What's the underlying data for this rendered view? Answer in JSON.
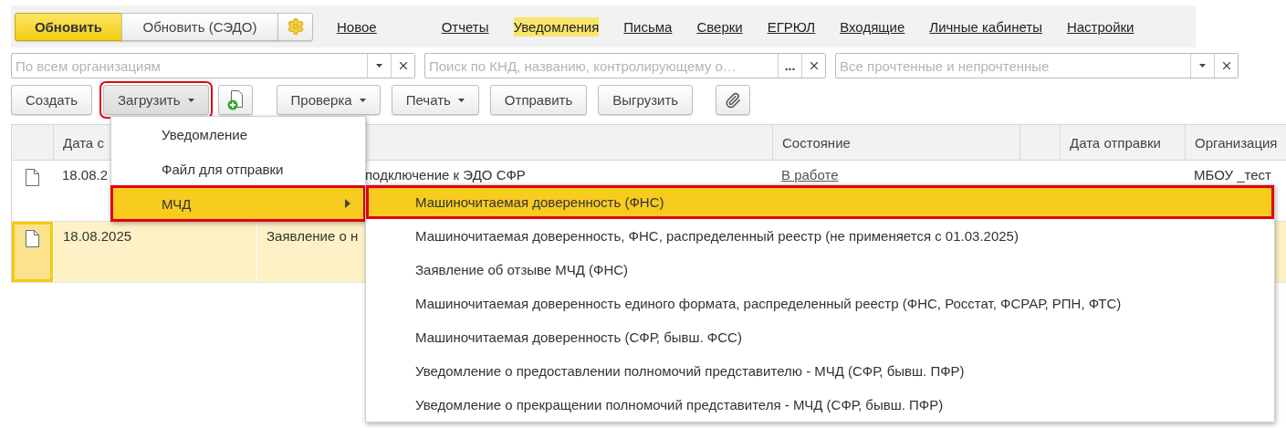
{
  "top_buttons": [
    {
      "label": "Обновить",
      "kind": "primary"
    },
    {
      "label": "Обновить (СЭДО)",
      "kind": "normal"
    },
    {
      "kind": "settings"
    }
  ],
  "nav_links": [
    {
      "label": "Новое",
      "selected": false
    },
    {
      "label": "Отчеты",
      "selected": false
    },
    {
      "label": "Уведомления",
      "selected": true
    },
    {
      "label": "Письма",
      "selected": false
    },
    {
      "label": "Сверки",
      "selected": false
    },
    {
      "label": "ЕГРЮЛ",
      "selected": false
    },
    {
      "label": "Входящие",
      "selected": false
    },
    {
      "label": "Личные кабинеты",
      "selected": false
    },
    {
      "label": "Настройки",
      "selected": false
    }
  ],
  "filters": [
    {
      "placeholder": "По всем организациям",
      "kind": "dropdown"
    },
    {
      "placeholder": "Поиск по КНД, названию, контролирующему о…",
      "kind": "choice",
      "button_label": "..."
    },
    {
      "placeholder": "Все прочтенные и непрочтенные",
      "kind": "dropdown"
    }
  ],
  "actions": [
    {
      "label": "Создать",
      "kind": "button",
      "highlighted": false
    },
    {
      "label": "Загрузить",
      "kind": "menu",
      "highlighted": true
    },
    {
      "kind": "add-file",
      "highlighted": false
    },
    {
      "label": "Проверка",
      "kind": "menu",
      "highlighted": false
    },
    {
      "label": "Печать",
      "kind": "menu",
      "highlighted": false
    },
    {
      "label": "Отправить",
      "kind": "button",
      "highlighted": false
    },
    {
      "label": "Выгрузить",
      "kind": "button",
      "highlighted": false
    },
    {
      "kind": "attach",
      "highlighted": false
    }
  ],
  "table": {
    "columns": [
      {
        "kind": "icon"
      },
      {
        "kind": "text",
        "label": "Дата с"
      },
      {
        "kind": "text"
      },
      {
        "kind": "text",
        "label": "Состояние"
      },
      {
        "kind": "text"
      },
      {
        "kind": "text",
        "label": "Дата отправки"
      },
      {
        "kind": "text",
        "label": "Организация"
      }
    ],
    "rows": [
      {
        "selected": false,
        "date": "18.08.2",
        "title": "подключение к ЭДО СФР",
        "status": "В работе",
        "organization": "МБОУ _тест"
      },
      {
        "selected": true,
        "date": "18.08.2025",
        "title": "Заявление о н"
      }
    ]
  },
  "menu": {
    "items": [
      {
        "label": "Уведомление",
        "selected": false,
        "highlighted": false,
        "has_submenu": false
      },
      {
        "label": "Файл для отправки",
        "selected": false,
        "highlighted": false,
        "has_submenu": false
      },
      {
        "label": "МЧД",
        "selected": true,
        "highlighted": true,
        "has_submenu": true
      }
    ]
  },
  "submenu": {
    "items": [
      {
        "label": "Машиночитаемая доверенность (ФНС)",
        "selected": true,
        "highlighted": true
      },
      {
        "label": "Машиночитаемая доверенность, ФНС, распределенный реестр (не применяется с 01.03.2025)",
        "selected": false,
        "highlighted": false
      },
      {
        "label": "Заявление об отзыве МЧД (ФНС)",
        "selected": false,
        "highlighted": false
      },
      {
        "label": "Машиночитаемая доверенность единого формата, распределенный реестр (ФНС, Росстат, ФСРАР, РПН, ФТС)",
        "selected": false,
        "highlighted": false
      },
      {
        "label": "Машиночитаемая доверенность (СФР, бывш. ФСС)",
        "selected": false,
        "highlighted": false
      },
      {
        "label": "Уведомление о предоставлении полномочий представителю - МЧД (СФР, бывш. ПФР)",
        "selected": false,
        "highlighted": false
      },
      {
        "label": "Уведомление о прекращении полномочий представителя - МЧД (СФР, бывш. ПФР)",
        "selected": false,
        "highlighted": false
      }
    ]
  }
}
